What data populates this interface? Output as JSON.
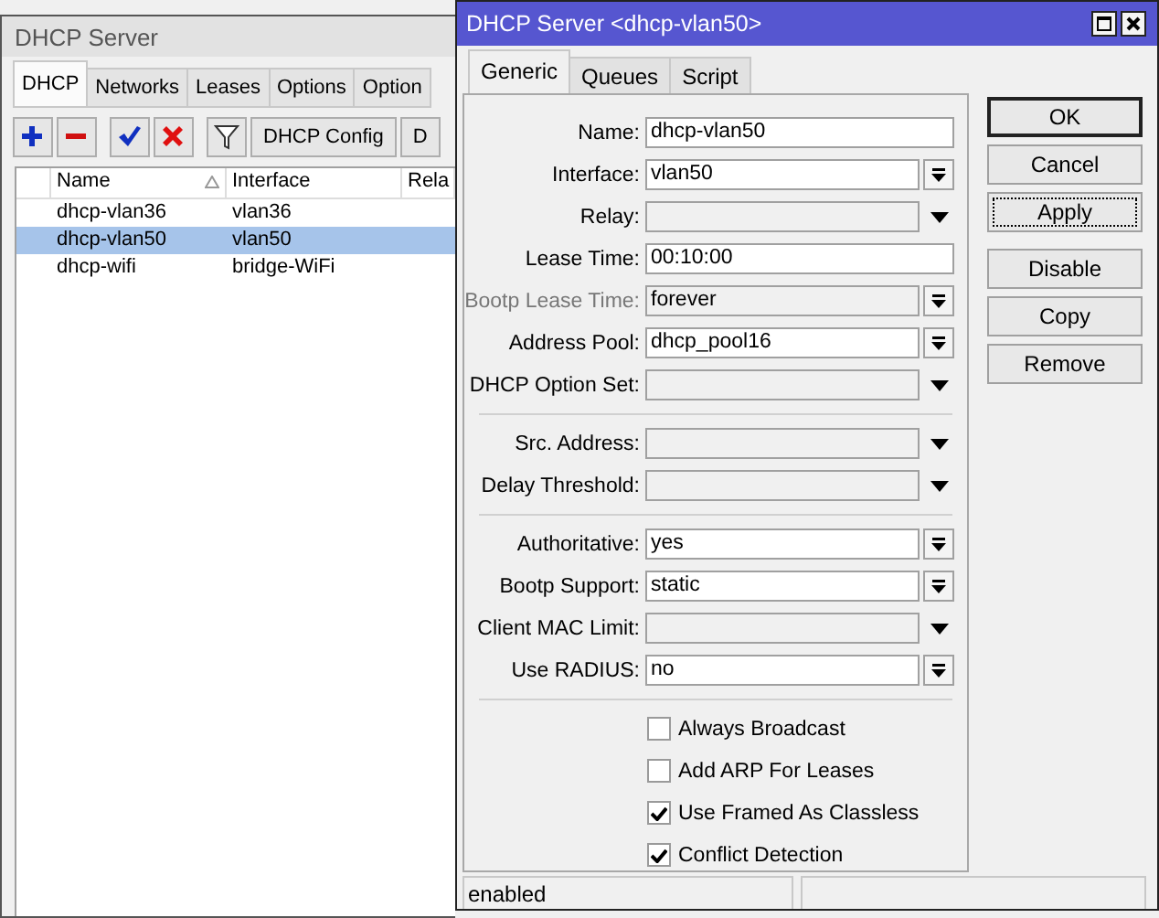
{
  "left_window": {
    "title": "DHCP Server",
    "tabs": [
      {
        "label": "DHCP",
        "selected": true
      },
      {
        "label": "Networks",
        "selected": false
      },
      {
        "label": "Leases",
        "selected": false
      },
      {
        "label": "Options",
        "selected": false
      },
      {
        "label": "Option",
        "selected": false
      }
    ],
    "toolbar_buttons": [
      "DHCP Config",
      "D"
    ],
    "table": {
      "columns": [
        "Name",
        "Interface",
        "Rela"
      ],
      "rows": [
        {
          "name": "dhcp-vlan36",
          "interface": "vlan36",
          "selected": false
        },
        {
          "name": "dhcp-vlan50",
          "interface": "vlan50",
          "selected": true
        },
        {
          "name": "dhcp-wifi",
          "interface": "bridge-WiFi",
          "selected": false
        }
      ]
    }
  },
  "dialog": {
    "title": "DHCP Server <dhcp-vlan50>",
    "tabs": [
      {
        "label": "Generic",
        "selected": true
      },
      {
        "label": "Queues",
        "selected": false
      },
      {
        "label": "Script",
        "selected": false
      }
    ],
    "fields": [
      {
        "kind": "text",
        "label": "Name:",
        "value": "dhcp-vlan50",
        "disabled": false
      },
      {
        "kind": "combo",
        "label": "Interface:",
        "value": "vlan50",
        "disabled": false
      },
      {
        "kind": "dropdown",
        "label": "Relay:",
        "disabled": false
      },
      {
        "kind": "text",
        "label": "Lease Time:",
        "value": "00:10:00",
        "disabled": false
      },
      {
        "kind": "combo",
        "label": "Bootp Lease Time:",
        "value": "forever",
        "disabled": true
      },
      {
        "kind": "combo",
        "label": "Address Pool:",
        "value": "dhcp_pool16",
        "disabled": false
      },
      {
        "kind": "dropdown",
        "label": "DHCP Option Set:",
        "disabled": false
      },
      {
        "kind": "separator"
      },
      {
        "kind": "dropdown",
        "label": "Src. Address:",
        "disabled": false
      },
      {
        "kind": "dropdown",
        "label": "Delay Threshold:",
        "disabled": false
      },
      {
        "kind": "separator"
      },
      {
        "kind": "combo",
        "label": "Authoritative:",
        "value": "yes",
        "disabled": false
      },
      {
        "kind": "combo",
        "label": "Bootp Support:",
        "value": "static",
        "disabled": false
      },
      {
        "kind": "dropdown",
        "label": "Client MAC Limit:",
        "disabled": false
      },
      {
        "kind": "combo",
        "label": "Use RADIUS:",
        "value": "no",
        "disabled": false
      },
      {
        "kind": "separator"
      },
      {
        "kind": "checkbox",
        "label": "Always Broadcast",
        "checked": false
      },
      {
        "kind": "checkbox",
        "label": "Add ARP For Leases",
        "checked": false
      },
      {
        "kind": "checkbox",
        "label": "Use Framed As Classless",
        "checked": true
      },
      {
        "kind": "checkbox",
        "label": "Conflict Detection",
        "checked": true
      }
    ],
    "button_groups": [
      [
        {
          "label": "OK",
          "default": true,
          "focused": false
        },
        {
          "label": "Cancel",
          "default": false,
          "focused": false
        },
        {
          "label": "Apply",
          "default": false,
          "focused": true
        }
      ],
      [
        {
          "label": "Disable",
          "default": false,
          "focused": false
        },
        {
          "label": "Copy",
          "default": false,
          "focused": false
        },
        {
          "label": "Remove",
          "default": false,
          "focused": false
        }
      ]
    ],
    "status": "enabled"
  }
}
